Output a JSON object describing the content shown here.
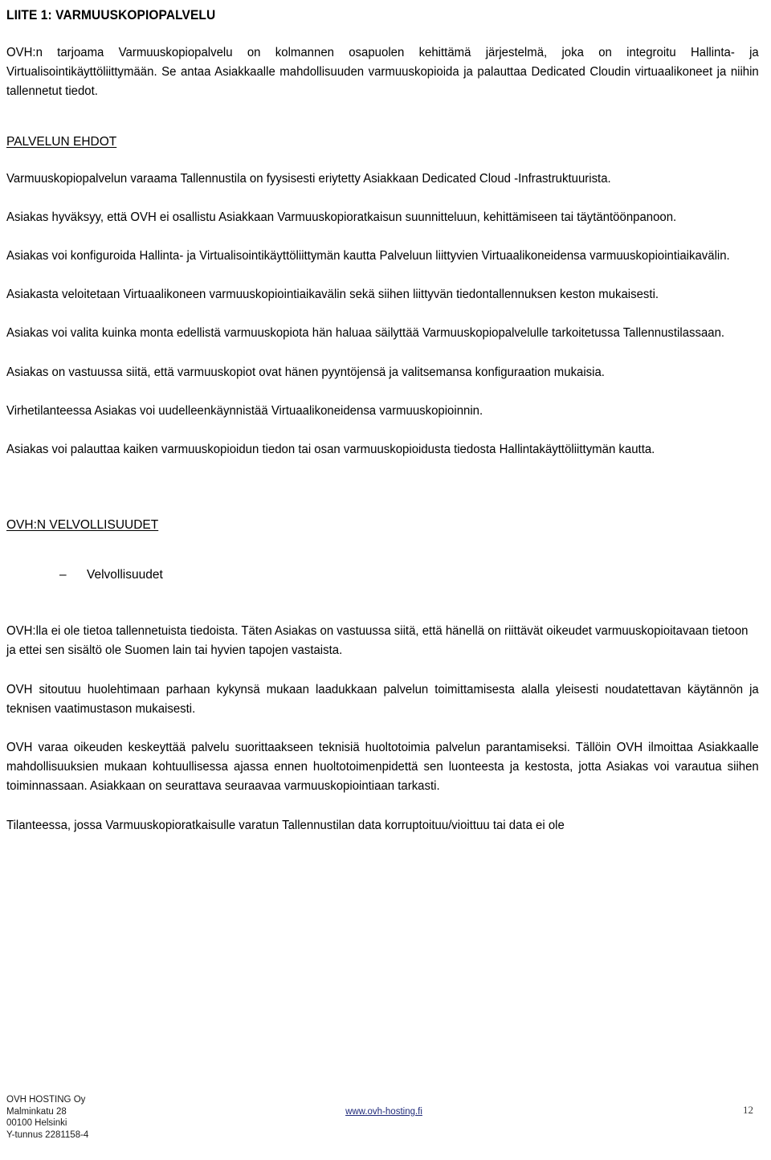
{
  "document": {
    "title": "LIITE 1: VARMUUSKOPIOPALVELU",
    "intro": "OVH:n tarjoama Varmuuskopiopalvelu on kolmannen osapuolen kehittämä järjestelmä, joka on integroitu Hallinta- ja Virtualisointikäyttöliittymään. Se antaa Asiakkaalle mahdollisuuden varmuuskopioida ja palauttaa Dedicated Cloudin virtuaalikoneet ja niihin tallennetut tiedot."
  },
  "sections": {
    "terms": {
      "heading": "PALVELUN EHDOT",
      "paragraphs": [
        "Varmuuskopiopalvelun varaama Tallennustila on fyysisesti eriytetty Asiakkaan Dedicated Cloud -Infrastruktuurista.",
        "Asiakas hyväksyy, että OVH ei osallistu Asiakkaan Varmuuskopioratkaisun suunnitteluun, kehittämiseen tai täytäntöönpanoon.",
        "Asiakas voi konfiguroida Hallinta- ja Virtualisointikäyttöliittymän kautta Palveluun liittyvien Virtuaalikoneidensa varmuuskopiointiaikavälin.",
        "Asiakasta veloitetaan Virtuaalikoneen varmuuskopiointiaikavälin sekä siihen liittyvän tiedontallennuksen keston mukaisesti.",
        "Asiakas voi valita kuinka monta edellistä varmuuskopiota hän haluaa säilyttää Varmuuskopiopalvelulle tarkoitetussa Tallennustilassaan.",
        "Asiakas on vastuussa siitä, että varmuuskopiot ovat hänen pyyntöjensä ja valitsemansa konfiguraation mukaisia.",
        "Virhetilanteessa Asiakas voi uudelleenkäynnistää Virtuaalikoneidensa varmuuskopioinnin.",
        "Asiakas voi palauttaa kaiken varmuuskopioidun tiedon tai osan varmuuskopioidusta tiedosta Hallintakäyttöliittymän kautta."
      ]
    },
    "obligations": {
      "heading": "OVH:N VELVOLLISUUDET",
      "bullet_dash": "–",
      "bullets": [
        "Velvollisuudet"
      ],
      "paragraphs": [
        "OVH:lla ei ole tietoa tallennetuista tiedoista. Täten Asiakas on vastuussa siitä, että hänellä on riittävät oikeudet varmuuskopioitavaan tietoon ja ettei sen sisältö ole Suomen lain tai hyvien tapojen vastaista.",
        "OVH sitoutuu huolehtimaan parhaan kykynsä mukaan laadukkaan palvelun toimittamisesta alalla yleisesti noudatettavan käytännön ja teknisen vaatimustason mukaisesti.",
        "OVH varaa oikeuden keskeyttää palvelu suorittaakseen teknisiä huoltotoimia palvelun parantamiseksi. Tällöin OVH ilmoittaa Asiakkaalle mahdollisuuksien mukaan kohtuullisessa ajassa ennen huoltotoimenpidettä sen luonteesta ja kestosta, jotta Asiakas voi varautua siihen toiminnassaan. Asiakkaan on seurattava seuraavaa varmuuskopiointiaan tarkasti.",
        "Tilanteessa, jossa Varmuuskopioratkaisulle varatun Tallennustilan data korruptoituu/vioittuu tai data ei ole"
      ]
    }
  },
  "footer": {
    "company": "OVH HOSTING Oy",
    "street": "Malminkatu 28",
    "city": "00100 Helsinki",
    "business_id": "Y-tunnus 2281158-4",
    "website": "www.ovh-hosting.fi",
    "page_number": "12",
    "link_color": "#1f2a7a"
  }
}
